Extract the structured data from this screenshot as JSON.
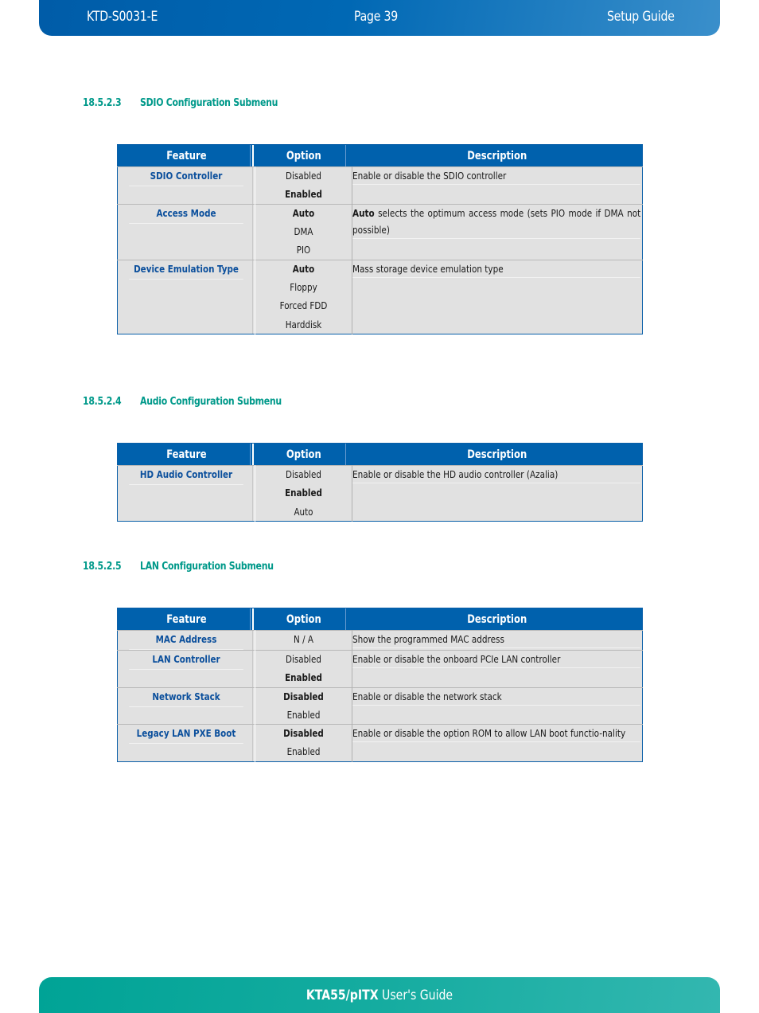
{
  "header": {
    "doc_id": "KTD-S0031-E",
    "page": "Page 39",
    "section": "Setup Guide"
  },
  "footer": {
    "product": "KTA55/pITX",
    "suffix": " User's Guide"
  },
  "colors": {
    "header_blue": "#0061ad",
    "section_green": "#00998a",
    "feature_blue": "#0b4f9c",
    "row_gray": "#e1e1e1",
    "footer_teal": "#15aca0"
  },
  "columns": {
    "feature": "Feature",
    "option": "Option",
    "description": "Description"
  },
  "sections": [
    {
      "number": "18.5.2.3",
      "title": "SDIO Configuration Submenu",
      "rows": [
        {
          "feature": "SDIO Controller",
          "options": [
            {
              "label": "Disabled",
              "default": false
            },
            {
              "label": "Enabled",
              "default": true
            }
          ],
          "description_bold": "",
          "description": "Enable or disable the SDIO controller"
        },
        {
          "feature": "Access Mode",
          "options": [
            {
              "label": "Auto",
              "default": true
            },
            {
              "label": "DMA",
              "default": false
            },
            {
              "label": "PIO",
              "default": false
            }
          ],
          "description_bold": "Auto",
          "description": " selects the optimum access mode (sets PIO mode if DMA not possible)"
        },
        {
          "feature": "Device Emulation Type",
          "options": [
            {
              "label": "Auto",
              "default": true
            },
            {
              "label": "Floppy",
              "default": false
            },
            {
              "label": "Forced FDD",
              "default": false
            },
            {
              "label": "Harddisk",
              "default": false
            }
          ],
          "description_bold": "",
          "description": "Mass storage device emulation type"
        }
      ]
    },
    {
      "number": "18.5.2.4",
      "title": "Audio Configuration Submenu",
      "rows": [
        {
          "feature": "HD Audio Controller",
          "options": [
            {
              "label": "Disabled",
              "default": false
            },
            {
              "label": "Enabled",
              "default": true
            },
            {
              "label": "Auto",
              "default": false
            }
          ],
          "description_bold": "",
          "description": "Enable or disable the HD audio controller (Azalia)"
        }
      ]
    },
    {
      "number": "18.5.2.5",
      "title": "LAN Configuration Submenu",
      "rows": [
        {
          "feature": "MAC Address",
          "options": [
            {
              "label": "N / A",
              "default": false
            }
          ],
          "description_bold": "",
          "description": "Show the programmed MAC address"
        },
        {
          "feature": "LAN Controller",
          "options": [
            {
              "label": "Disabled",
              "default": false
            },
            {
              "label": "Enabled",
              "default": true
            }
          ],
          "description_bold": "",
          "description": "Enable or disable the onboard PCIe LAN controller"
        },
        {
          "feature": "Network Stack",
          "options": [
            {
              "label": "Disabled",
              "default": true
            },
            {
              "label": "Enabled",
              "default": false
            }
          ],
          "description_bold": "",
          "description": "Enable or disable the network stack"
        },
        {
          "feature": "Legacy LAN PXE Boot",
          "options": [
            {
              "label": "Disabled",
              "default": true
            },
            {
              "label": "Enabled",
              "default": false
            }
          ],
          "description_bold": "",
          "description": "Enable or disable the option ROM to allow LAN boot functio-nality"
        }
      ]
    }
  ]
}
